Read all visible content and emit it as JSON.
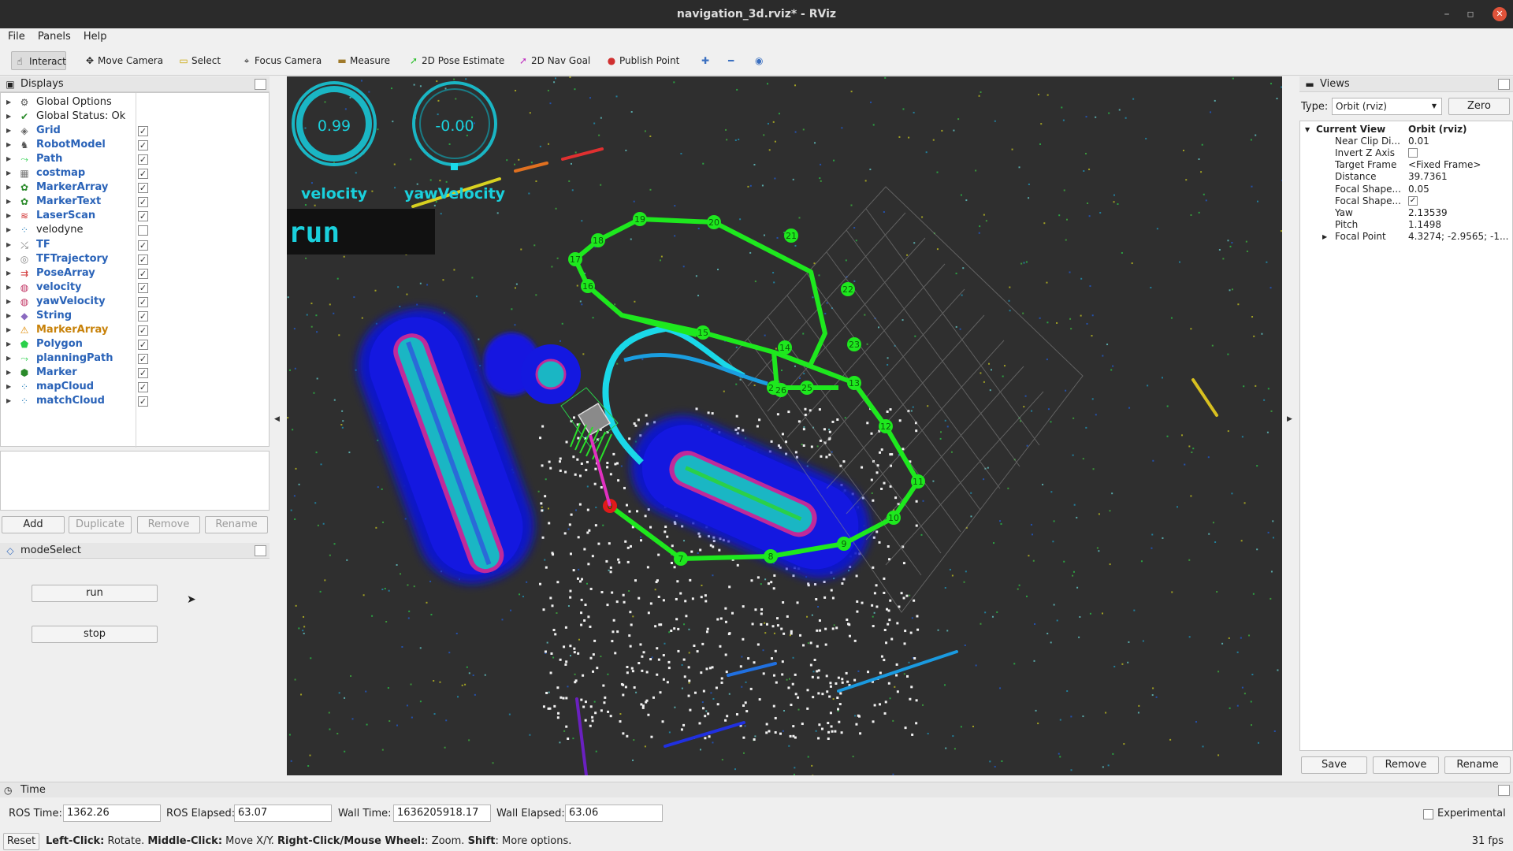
{
  "window": {
    "title": "navigation_3d.rviz* - RViz"
  },
  "menu": [
    "File",
    "Panels",
    "Help"
  ],
  "toolbar": {
    "interact": "Interact",
    "move_camera": "Move Camera",
    "select": "Select",
    "focus_camera": "Focus Camera",
    "measure": "Measure",
    "pose_estimate": "2D Pose Estimate",
    "nav_goal": "2D Nav Goal",
    "publish_point": "Publish Point"
  },
  "displays": {
    "title": "Displays",
    "items": [
      {
        "label": "Global Options",
        "style": "plain",
        "icon": "gear-icon",
        "checked": null
      },
      {
        "label": "Global Status: Ok",
        "style": "plain",
        "icon": "check-icon",
        "checked": null
      },
      {
        "label": "Grid",
        "style": "blue",
        "icon": "grid-icon",
        "checked": true
      },
      {
        "label": "RobotModel",
        "style": "blue",
        "icon": "robot-icon",
        "checked": true
      },
      {
        "label": "Path",
        "style": "blue",
        "icon": "path-icon",
        "checked": true
      },
      {
        "label": "costmap",
        "style": "blue",
        "icon": "map-icon",
        "checked": true
      },
      {
        "label": "MarkerArray",
        "style": "blue",
        "icon": "markers-icon",
        "checked": true
      },
      {
        "label": "MarkerText",
        "style": "blue",
        "icon": "markers-icon",
        "checked": true
      },
      {
        "label": "LaserScan",
        "style": "blue",
        "icon": "laser-icon",
        "checked": true
      },
      {
        "label": "velodyne",
        "style": "plain",
        "icon": "cloud-icon",
        "checked": false
      },
      {
        "label": "TF",
        "style": "blue",
        "icon": "tf-icon",
        "checked": true
      },
      {
        "label": "TFTrajectory",
        "style": "blue",
        "icon": "trajectory-icon",
        "checked": true
      },
      {
        "label": "PoseArray",
        "style": "blue",
        "icon": "pose-icon",
        "checked": true
      },
      {
        "label": "velocity",
        "style": "blue",
        "icon": "gauge-icon",
        "checked": true
      },
      {
        "label": "yawVelocity",
        "style": "blue",
        "icon": "gauge-icon",
        "checked": true
      },
      {
        "label": "String",
        "style": "blue",
        "icon": "diamond-icon",
        "checked": true
      },
      {
        "label": "MarkerArray",
        "style": "orange",
        "icon": "warning-icon",
        "checked": true
      },
      {
        "label": "Polygon",
        "style": "blue",
        "icon": "polygon-icon",
        "checked": true
      },
      {
        "label": "planningPath",
        "style": "blue",
        "icon": "path-icon",
        "checked": true
      },
      {
        "label": "Marker",
        "style": "blue",
        "icon": "cube-icon",
        "checked": true
      },
      {
        "label": "mapCloud",
        "style": "blue",
        "icon": "cloud-icon",
        "checked": true
      },
      {
        "label": "matchCloud",
        "style": "blue",
        "icon": "cloud-icon",
        "checked": true
      }
    ],
    "buttons": {
      "add": "Add",
      "duplicate": "Duplicate",
      "remove": "Remove",
      "rename": "Rename"
    }
  },
  "mode_select": {
    "title": "modeSelect",
    "run": "run",
    "stop": "stop"
  },
  "overlay": {
    "velocity_value": "0.99",
    "velocity_label": "velocity",
    "yaw_value": "-0.00",
    "yaw_label": "yawVelocity",
    "mode_text": "run"
  },
  "waypoints": [
    "0",
    "7",
    "8",
    "9",
    "10",
    "11",
    "12",
    "13",
    "14",
    "15",
    "16",
    "17",
    "18",
    "19",
    "20",
    "21",
    "22",
    "23",
    "24",
    "25",
    "26"
  ],
  "views": {
    "title": "Views",
    "type_label": "Type:",
    "type_value": "Orbit (rviz)",
    "zero": "Zero",
    "props": [
      {
        "k": "Current View",
        "v": "Orbit (rviz)",
        "bold": true
      },
      {
        "k": "Near Clip Di...",
        "v": "0.01"
      },
      {
        "k": "Invert Z Axis",
        "v": ""
      },
      {
        "k": "Target Frame",
        "v": "<Fixed Frame>"
      },
      {
        "k": "Distance",
        "v": "39.7361"
      },
      {
        "k": "Focal Shape...",
        "v": "0.05"
      },
      {
        "k": "Focal Shape...",
        "v": ""
      },
      {
        "k": "Yaw",
        "v": "2.13539"
      },
      {
        "k": "Pitch",
        "v": "1.1498"
      },
      {
        "k": "Focal Point",
        "v": "4.3274; -2.9565; -1..."
      }
    ],
    "save": "Save",
    "remove": "Remove",
    "rename": "Rename"
  },
  "time": {
    "title": "Time",
    "ros_time_label": "ROS Time:",
    "ros_time": "1362.26",
    "ros_elapsed_label": "ROS Elapsed:",
    "ros_elapsed": "63.07",
    "wall_time_label": "Wall Time:",
    "wall_time": "1636205918.17",
    "wall_elapsed_label": "Wall Elapsed:",
    "wall_elapsed": "63.06",
    "experimental": "Experimental"
  },
  "status": {
    "reset": "Reset",
    "left_click": "Left-Click:",
    "left_click_desc": " Rotate. ",
    "middle_click": "Middle-Click:",
    "middle_click_desc": " Move X/Y. ",
    "right_click": "Right-Click/Mouse Wheel:",
    "right_click_desc": ": Zoom. ",
    "shift": "Shift",
    "shift_desc": ": More options.",
    "fps": "31 fps"
  }
}
